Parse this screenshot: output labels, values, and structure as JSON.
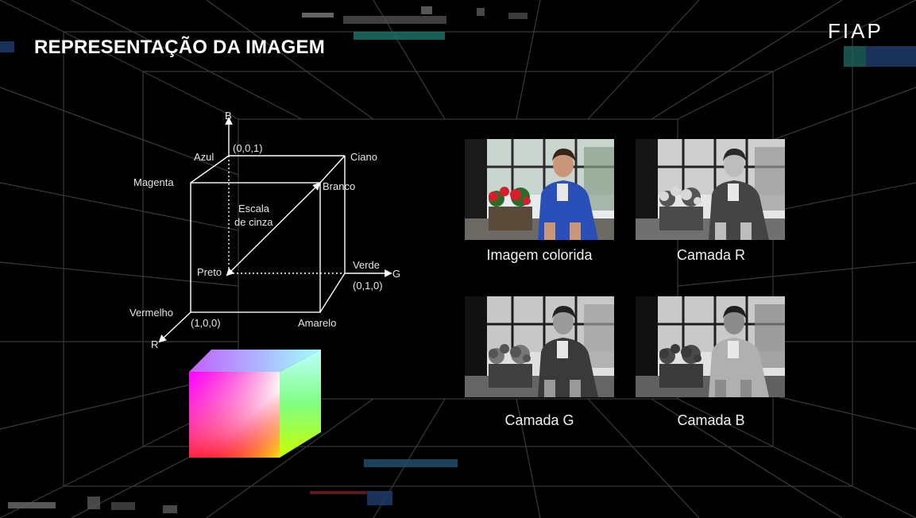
{
  "slide": {
    "title": "REPRESENTAÇÃO DA IMAGEM",
    "logo": "FIAP"
  },
  "rgb_cube": {
    "axis_b": "B",
    "axis_g": "G",
    "axis_r": "R",
    "coord_blue": "(0,0,1)",
    "coord_green": "(0,1,0)",
    "coord_red": "(1,0,0)",
    "azul": "Azul",
    "ciano": "Ciano",
    "magenta": "Magenta",
    "branco": "Branco",
    "escala_line1": "Escala",
    "escala_line2": "de cinza",
    "preto": "Preto",
    "verde": "Verde",
    "vermelho": "Vermelho",
    "amarelo": "Amarelo"
  },
  "photos": [
    {
      "caption": "Imagem colorida",
      "mode": "color"
    },
    {
      "caption": "Camada R",
      "mode": "r"
    },
    {
      "caption": "Camada G",
      "mode": "g"
    },
    {
      "caption": "Camada B",
      "mode": "b"
    }
  ],
  "colors": {
    "background": "#000000",
    "grid": "#3a3a3a",
    "text": "#ffffff"
  }
}
